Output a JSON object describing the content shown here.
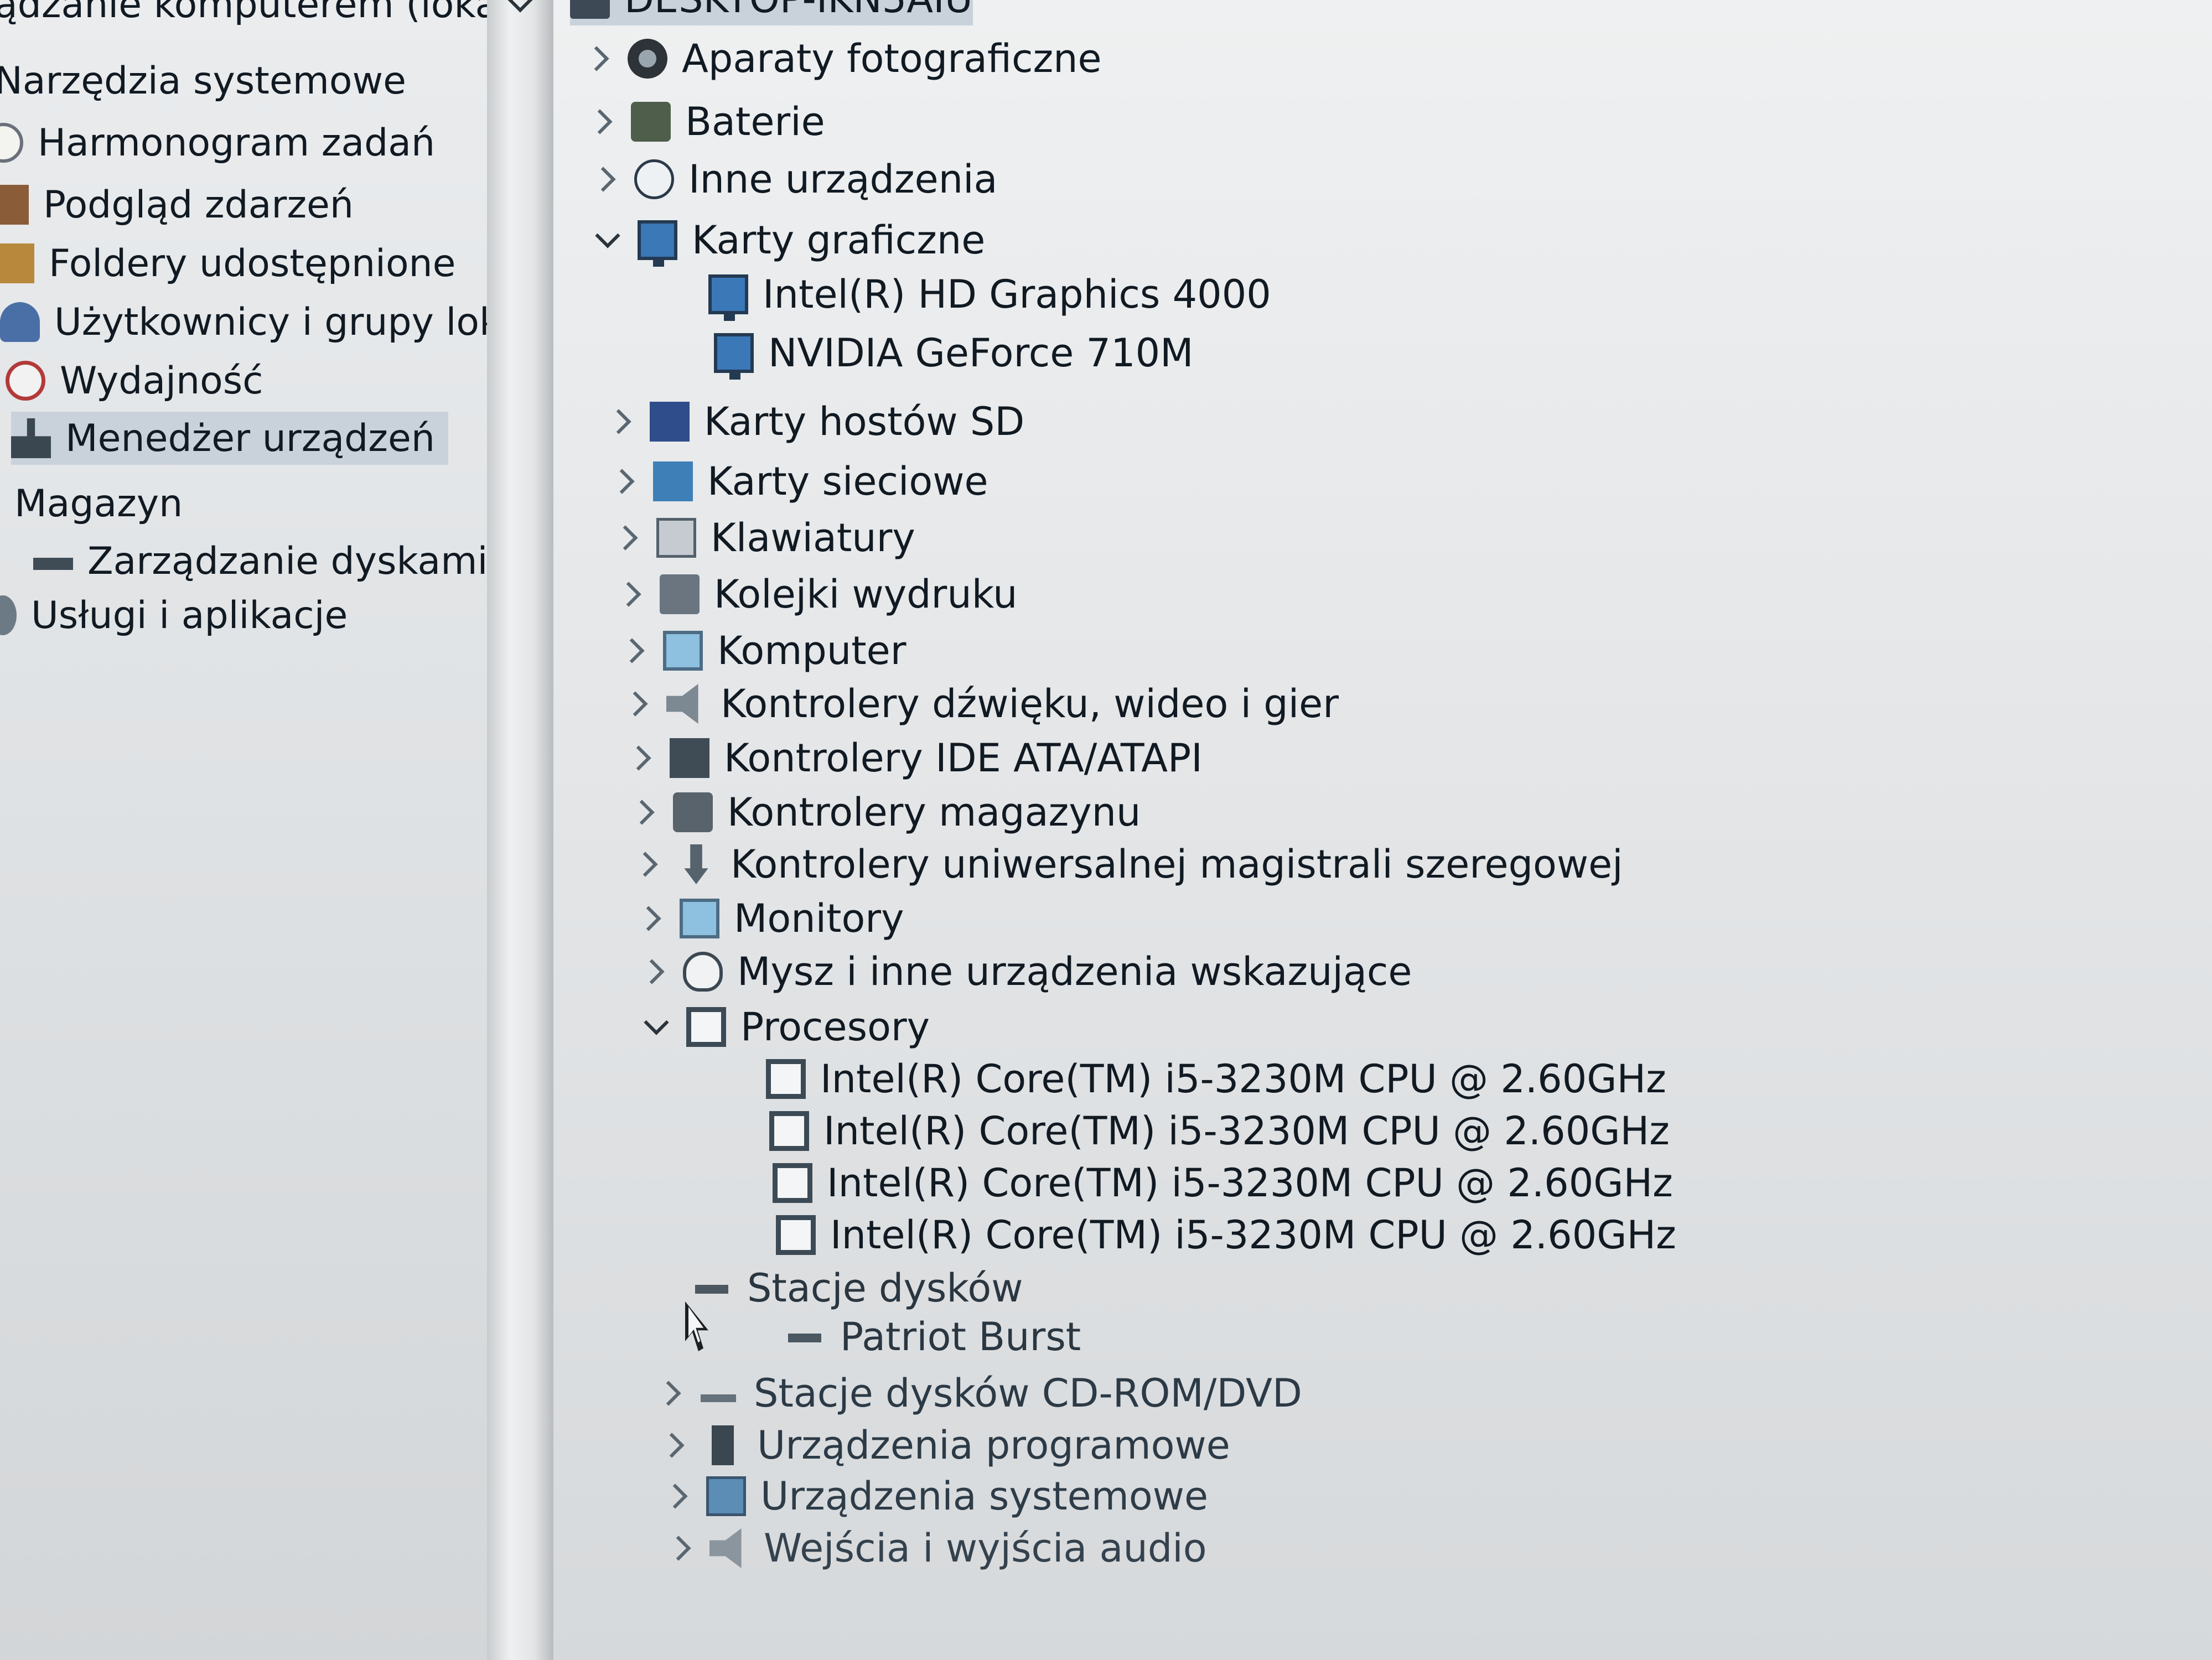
{
  "left_pane": {
    "root_label": "ądzanie komputerem (loka",
    "system_tools": "Narzędzia systemowe",
    "items": [
      {
        "label": "Harmonogram zadań",
        "icon": "clock-icon"
      },
      {
        "label": "Podgląd zdarzeń",
        "icon": "event-log-icon"
      },
      {
        "label": "Foldery udostępnione",
        "icon": "shared-folder-icon"
      },
      {
        "label": "Użytkownicy i grupy lok",
        "icon": "users-icon"
      },
      {
        "label": "Wydajność",
        "icon": "performance-icon"
      },
      {
        "label": "Menedżer urządzeń",
        "icon": "device-manager-icon",
        "selected": true
      }
    ],
    "storage": "Magazyn",
    "disk_management": "Zarządzanie dyskami",
    "services": "Usługi i aplikacje"
  },
  "right_pane": {
    "root": "DESKTOP-IKN5AIU",
    "categories": [
      {
        "label": "Aparaty fotograficzne",
        "state": "collapsed"
      },
      {
        "label": "Baterie",
        "state": "collapsed"
      },
      {
        "label": "Inne urządzenia",
        "state": "collapsed"
      },
      {
        "label": "Karty graficzne",
        "state": "expanded",
        "children": [
          "Intel(R) HD Graphics 4000",
          "NVIDIA GeForce 710M"
        ]
      },
      {
        "label": "Karty hostów SD",
        "state": "collapsed"
      },
      {
        "label": "Karty sieciowe",
        "state": "collapsed"
      },
      {
        "label": "Klawiatury",
        "state": "collapsed"
      },
      {
        "label": "Kolejki wydruku",
        "state": "collapsed"
      },
      {
        "label": "Komputer",
        "state": "collapsed"
      },
      {
        "label": "Kontrolery dźwięku, wideo i gier",
        "state": "collapsed"
      },
      {
        "label": "Kontrolery IDE ATA/ATAPI",
        "state": "collapsed"
      },
      {
        "label": "Kontrolery magazynu",
        "state": "collapsed"
      },
      {
        "label": "Kontrolery uniwersalnej magistrali szeregowej",
        "state": "collapsed"
      },
      {
        "label": "Monitory",
        "state": "collapsed"
      },
      {
        "label": "Mysz i inne urządzenia wskazujące",
        "state": "collapsed"
      },
      {
        "label": "Procesory",
        "state": "expanded",
        "children": [
          "Intel(R) Core(TM) i5-3230M CPU @ 2.60GHz",
          "Intel(R) Core(TM) i5-3230M CPU @ 2.60GHz",
          "Intel(R) Core(TM) i5-3230M CPU @ 2.60GHz",
          "Intel(R) Core(TM) i5-3230M CPU @ 2.60GHz"
        ]
      },
      {
        "label": "Stacje dysków",
        "state": "expanded",
        "children": [
          "Patriot Burst"
        ]
      },
      {
        "label": "Stacje dysków CD-ROM/DVD",
        "state": "collapsed"
      },
      {
        "label": "Urządzenia programowe",
        "state": "collapsed"
      },
      {
        "label": "Urządzenia systemowe",
        "state": "collapsed"
      },
      {
        "label": "Wejścia i wyjścia audio",
        "state": "collapsed"
      }
    ]
  }
}
